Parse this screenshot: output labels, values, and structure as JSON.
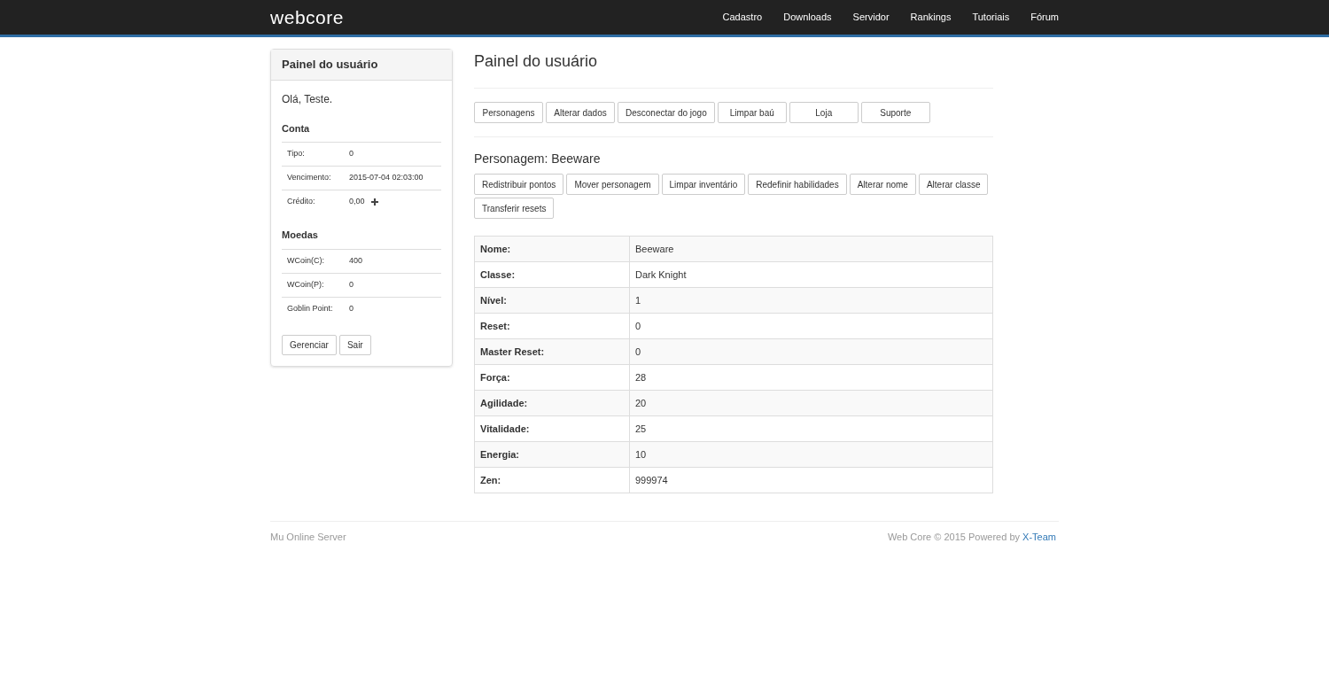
{
  "navbar": {
    "brand": "webcore",
    "links": [
      "Cadastro",
      "Downloads",
      "Servidor",
      "Rankings",
      "Tutoriais",
      "Fórum"
    ]
  },
  "sidebar": {
    "title": "Painel do usuário",
    "greeting": "Olá, Teste.",
    "sections": [
      {
        "title": "Conta",
        "rows": [
          {
            "label": "Tipo:",
            "value": "0"
          },
          {
            "label": "Vencimento:",
            "value": "2015-07-04 02:03:00"
          },
          {
            "label": "Crédito:",
            "value": "0,00",
            "add": true
          }
        ]
      },
      {
        "title": "Moedas",
        "rows": [
          {
            "label": "WCoin(C):",
            "value": "400"
          },
          {
            "label": "WCoin(P):",
            "value": "0"
          },
          {
            "label": "Goblin Point:",
            "value": "0"
          }
        ]
      }
    ],
    "buttons": [
      "Gerenciar",
      "Sair"
    ]
  },
  "main": {
    "title": "Painel do usuário",
    "menu_buttons": [
      "Personagens",
      "Alterar dados",
      "Desconectar do jogo",
      "Limpar baú",
      "Loja",
      "Suporte"
    ],
    "character_heading": "Personagem: Beeware",
    "character_buttons": [
      "Redistribuir pontos",
      "Mover personagem",
      "Limpar inventário",
      "Redefinir habilidades",
      "Alterar nome",
      "Alterar classe",
      "Transferir resets"
    ],
    "table": [
      {
        "label": "Nome:",
        "value": "Beeware"
      },
      {
        "label": "Classe:",
        "value": "Dark Knight"
      },
      {
        "label": "Nível:",
        "value": "1"
      },
      {
        "label": "Reset:",
        "value": "0"
      },
      {
        "label": "Master Reset:",
        "value": "0"
      },
      {
        "label": "Força:",
        "value": "28"
      },
      {
        "label": "Agilidade:",
        "value": "20"
      },
      {
        "label": "Vitalidade:",
        "value": "25"
      },
      {
        "label": "Energia:",
        "value": "10"
      },
      {
        "label": "Zen:",
        "value": "999974"
      }
    ]
  },
  "footer": {
    "left": "Mu Online Server",
    "right": "Web Core © 2015 Powered by",
    "link": "X-Team"
  }
}
